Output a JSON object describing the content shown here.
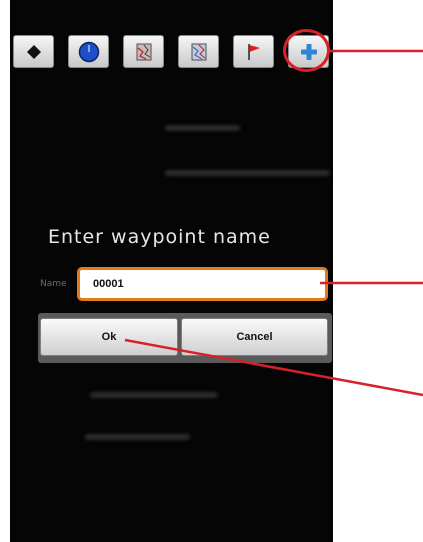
{
  "toolbar": {
    "buttons": [
      {
        "name": "waypoint-diamond-icon"
      },
      {
        "name": "compass-circle-icon"
      },
      {
        "name": "map-icon"
      },
      {
        "name": "map-layers-icon"
      },
      {
        "name": "flag-icon"
      },
      {
        "name": "add-waypoint-icon"
      }
    ]
  },
  "dialog": {
    "title": "Enter waypoint name",
    "name_label": "Name",
    "name_value": "00001",
    "ok_label": "Ok",
    "cancel_label": "Cancel"
  },
  "colors": {
    "accent": "#e37a1c",
    "callout": "#d8202a",
    "blue_icon": "#1f4fc8",
    "plus_icon": "#2f86d8",
    "flag_icon": "#e01c1c"
  }
}
